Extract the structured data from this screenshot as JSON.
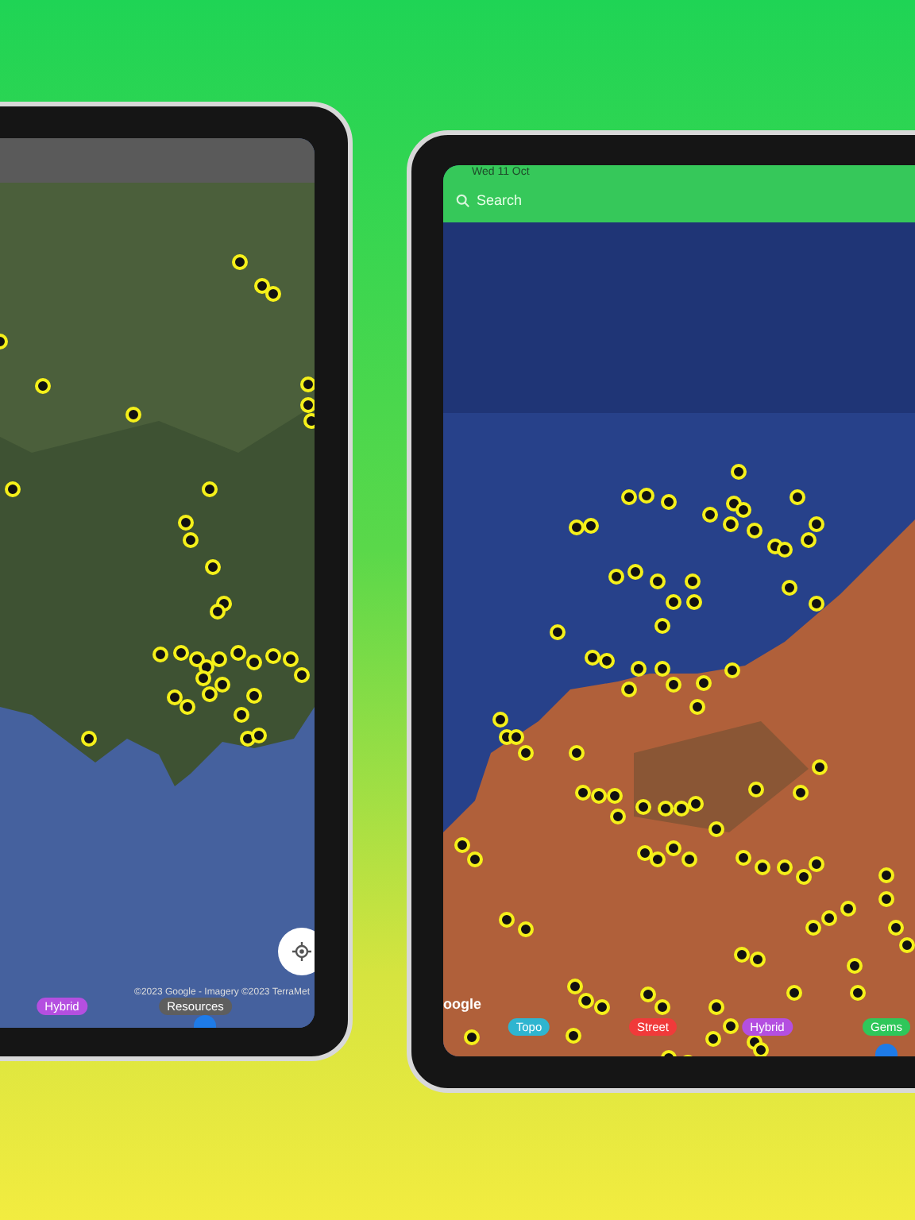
{
  "left_device": {
    "map_attribution": "©2023 Google - Imagery ©2023 TerraMet",
    "layers": [
      {
        "label": "Hybrid",
        "color": "#b44fe0"
      },
      {
        "label": "Resources",
        "color": "#5e5e5e"
      }
    ]
  },
  "right_device": {
    "status_bar": {
      "date": "Wed 11 Oct"
    },
    "search": {
      "placeholder": "Search"
    },
    "map_logo": "oogle",
    "layers": [
      {
        "label": "Topo",
        "color": "#2fb5d0"
      },
      {
        "label": "Street",
        "color": "#f03a3a"
      },
      {
        "label": "Hybrid",
        "color": "#b44fe0"
      },
      {
        "label": "Gems",
        "color": "#2fc75a"
      }
    ]
  }
}
